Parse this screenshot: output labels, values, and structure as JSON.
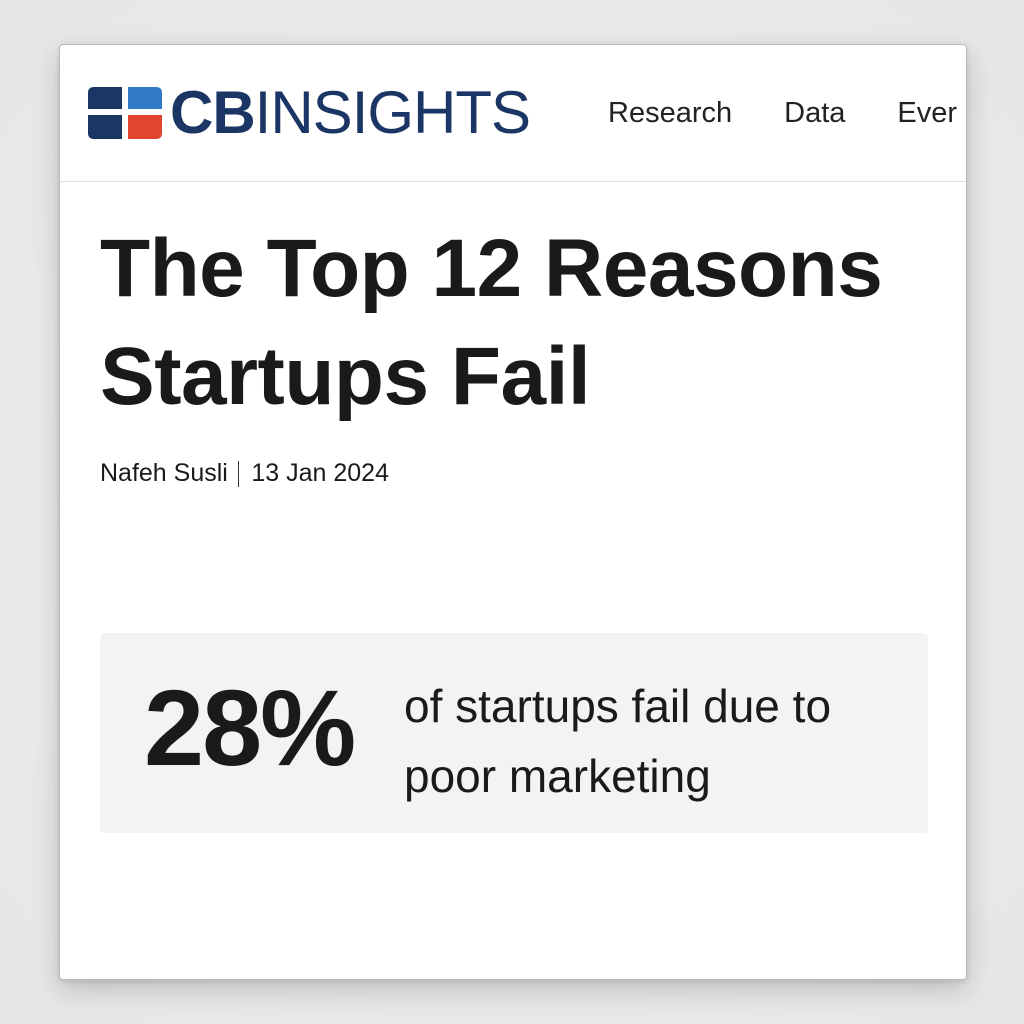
{
  "brand": {
    "logo_bold": "CB",
    "logo_regular": "INSIGHTS",
    "colors": {
      "navy": "#1b3665",
      "red": "#e0452f",
      "blue": "#2f79c6"
    }
  },
  "nav": {
    "items": [
      "Research",
      "Data",
      "Ever"
    ]
  },
  "article": {
    "title": "The Top 12 Reasons Startups Fail",
    "author": "Nafeh Susli",
    "date": "13 Jan 2024"
  },
  "stat": {
    "value": "28%",
    "text": "of startups fail due to poor marketing"
  }
}
